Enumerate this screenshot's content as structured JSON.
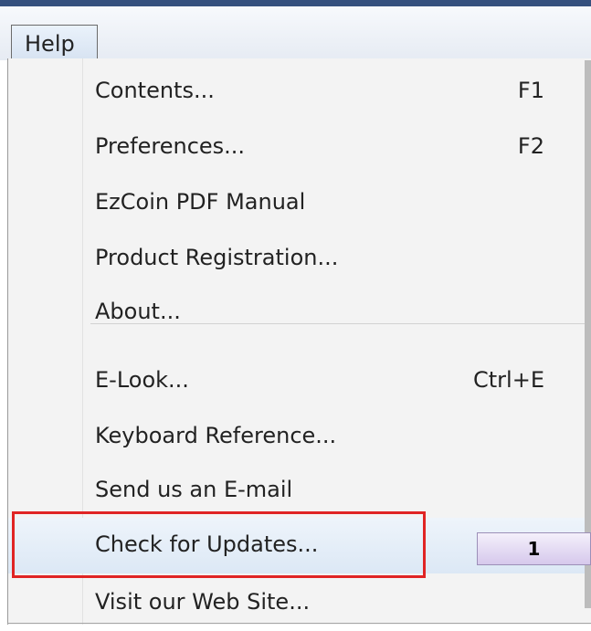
{
  "menubar": {
    "help_label": "Help"
  },
  "menu": {
    "items": [
      {
        "label": "Contents...",
        "shortcut": "F1"
      },
      {
        "label": "Preferences...",
        "shortcut": "F2"
      },
      {
        "label": "EzCoin PDF Manual",
        "shortcut": ""
      },
      {
        "label": "Product Registration...",
        "shortcut": ""
      },
      {
        "label": "About...",
        "shortcut": ""
      },
      {
        "label": "E-Look...",
        "shortcut": "Ctrl+E"
      },
      {
        "label": "Keyboard Reference...",
        "shortcut": ""
      },
      {
        "label": "Send us an E-mail",
        "shortcut": ""
      },
      {
        "label": "Check for Updates...",
        "shortcut": ""
      },
      {
        "label": "Visit our Web Site...",
        "shortcut": ""
      }
    ]
  },
  "annotation": {
    "callout_label": "1",
    "highlight_color": "#e02424"
  }
}
